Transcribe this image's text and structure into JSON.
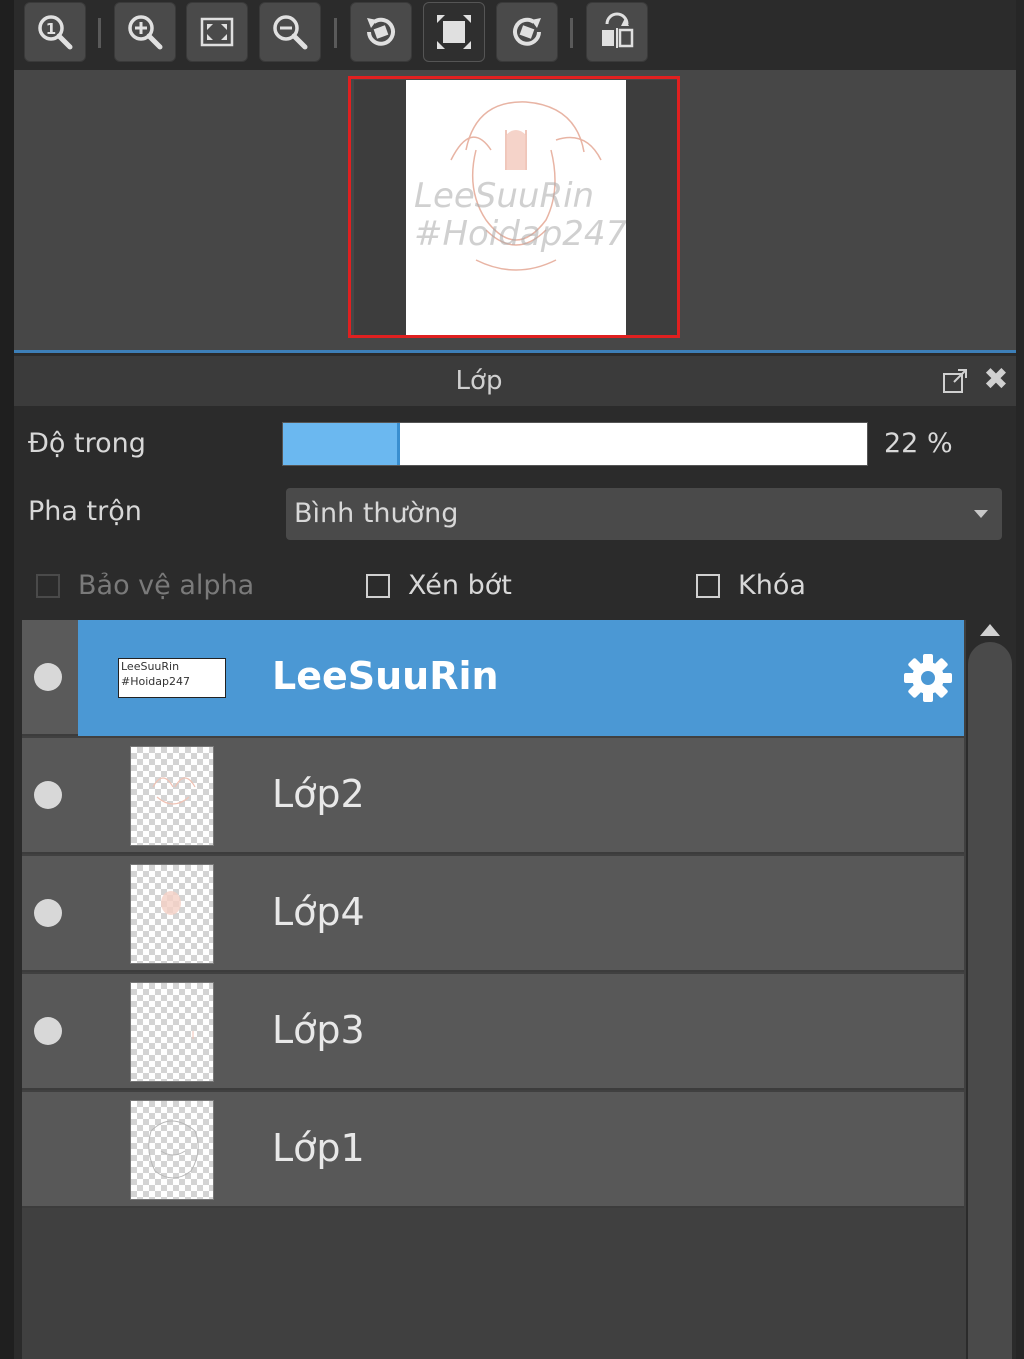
{
  "panel": {
    "title": "Lớp"
  },
  "opacity": {
    "label": "Độ trong",
    "value_text": "22 %",
    "value": 0.2
  },
  "blend": {
    "label": "Pha trộn",
    "selected": "Bình thường"
  },
  "options": {
    "protect_alpha": "Bảo vệ alpha",
    "clipping": "Xén bớt",
    "lock": "Khóa"
  },
  "layers": [
    {
      "name": "LeeSuuRin",
      "selected": true,
      "visible": true,
      "thumb_text": [
        "LeeSuuRin",
        "#Hoidap247"
      ]
    },
    {
      "name": "Lớp2",
      "selected": false,
      "visible": true
    },
    {
      "name": "Lớp4",
      "selected": false,
      "visible": true
    },
    {
      "name": "Lớp3",
      "selected": false,
      "visible": true
    },
    {
      "name": "Lớp1",
      "selected": false,
      "visible": false
    }
  ],
  "navigator": {
    "watermark_line1": "LeeSuuRin",
    "watermark_line2": "#Hoidap247"
  },
  "colors": {
    "selected_row": "#4b98d4",
    "opacity_fill": "#6bb8f0",
    "viewport_border": "#e02020"
  }
}
